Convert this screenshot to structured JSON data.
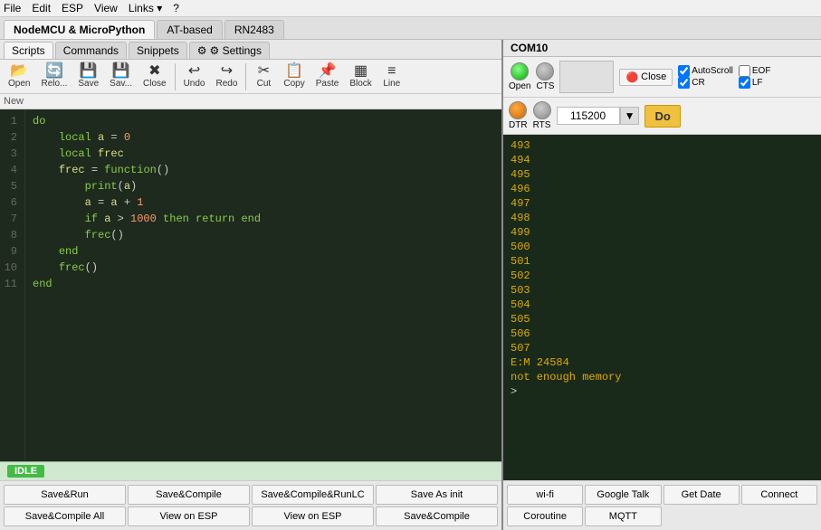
{
  "menu": {
    "items": [
      "File",
      "Edit",
      "ESP",
      "View",
      "Links",
      "?"
    ]
  },
  "main_tabs": [
    {
      "label": "NodeMCU & MicroPython",
      "active": true
    },
    {
      "label": "AT-based",
      "active": false
    },
    {
      "label": "RN2483",
      "active": false
    }
  ],
  "sub_tabs": [
    {
      "label": "Scripts",
      "active": true
    },
    {
      "label": "Commands",
      "active": false
    },
    {
      "label": "Snippets",
      "active": false
    },
    {
      "label": "⚙ Settings",
      "active": false
    }
  ],
  "toolbar": {
    "buttons": [
      {
        "label": "Open",
        "icon": "📂"
      },
      {
        "label": "Relo...",
        "icon": "🔄"
      },
      {
        "label": "Save",
        "icon": "💾"
      },
      {
        "label": "Sav...",
        "icon": "💾"
      },
      {
        "label": "Close",
        "icon": "✖"
      },
      {
        "label": "Undo",
        "icon": "↩"
      },
      {
        "label": "Redo",
        "icon": "↪"
      },
      {
        "label": "Cut",
        "icon": "✂"
      },
      {
        "label": "Copy",
        "icon": "📋"
      },
      {
        "label": "Paste",
        "icon": "📌"
      },
      {
        "label": "Block",
        "icon": "▦"
      },
      {
        "label": "Line",
        "icon": "≡"
      }
    ]
  },
  "new_label": "New",
  "code": {
    "lines": [
      {
        "num": 1,
        "text": "do",
        "type": "kw"
      },
      {
        "num": 2,
        "text": "    local a = 0"
      },
      {
        "num": 3,
        "text": "    local frec"
      },
      {
        "num": 4,
        "text": "    frec = function()"
      },
      {
        "num": 5,
        "text": "        print(a)"
      },
      {
        "num": 6,
        "text": "        a = a + 1"
      },
      {
        "num": 7,
        "text": "        if a > 1000 then return end"
      },
      {
        "num": 8,
        "text": "        frec()"
      },
      {
        "num": 9,
        "text": "    end"
      },
      {
        "num": 10,
        "text": "    frec()"
      },
      {
        "num": 11,
        "text": "end"
      }
    ]
  },
  "status": {
    "label": "IDLE"
  },
  "bottom_buttons": [
    {
      "label": "Save&Run"
    },
    {
      "label": "Save&Compile"
    },
    {
      "label": "Save&Compile&RunLC"
    },
    {
      "label": "Save As init"
    },
    {
      "label": "Save&Compile All"
    },
    {
      "label": "View on ESP"
    },
    {
      "label": "View on ESP"
    },
    {
      "label": "Save&Compile"
    }
  ],
  "com": {
    "port": "COM10",
    "open_label": "Open",
    "cts_label": "CTS",
    "dtr_label": "DTR",
    "rts_label": "RTS",
    "close_label": "Close",
    "baud": "115200",
    "do_label": "Do",
    "checkboxes": {
      "autoscroll": "AutoScroll",
      "cr": "CR",
      "eof": "EOF",
      "lf": "LF"
    }
  },
  "serial_lines": [
    "493",
    "494",
    "495",
    "496",
    "497",
    "498",
    "499",
    "500",
    "501",
    "502",
    "503",
    "504",
    "505",
    "506",
    "507",
    "E:M 24584",
    "not enough memory",
    ">"
  ],
  "right_buttons": [
    {
      "label": "wi-fi"
    },
    {
      "label": "Google Talk"
    },
    {
      "label": "Get Date"
    },
    {
      "label": "Connect"
    },
    {
      "label": "Coroutine"
    },
    {
      "label": "MQTT"
    }
  ]
}
